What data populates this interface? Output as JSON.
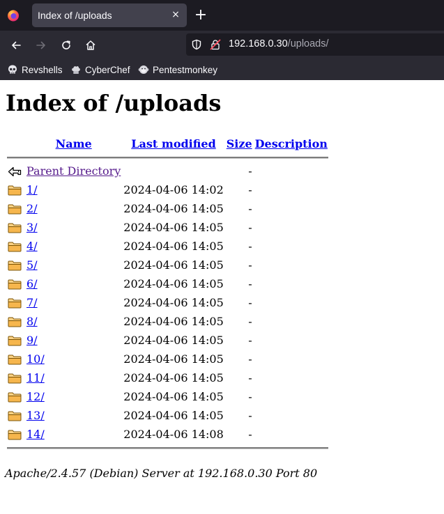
{
  "browser": {
    "tab_title": "Index of /uploads",
    "tab_close": "×",
    "new_tab": "+",
    "url_host": "192.168.0.30",
    "url_path": "/uploads/",
    "bookmarks": [
      {
        "label": "Revshells",
        "icon": "skull-icon"
      },
      {
        "label": "CyberChef",
        "icon": "chef-hat-icon"
      },
      {
        "label": "Pentestmonkey",
        "icon": "monkey-icon"
      }
    ]
  },
  "page": {
    "title": "Index of /uploads",
    "columns": {
      "name": "Name",
      "last_modified": "Last modified",
      "size": "Size",
      "description": "Description"
    },
    "parent": {
      "label": "Parent Directory",
      "size": "-"
    },
    "rows": [
      {
        "name": "1/",
        "modified": "2024-04-06 14:02",
        "size": "-"
      },
      {
        "name": "2/",
        "modified": "2024-04-06 14:05",
        "size": "-"
      },
      {
        "name": "3/",
        "modified": "2024-04-06 14:05",
        "size": "-"
      },
      {
        "name": "4/",
        "modified": "2024-04-06 14:05",
        "size": "-"
      },
      {
        "name": "5/",
        "modified": "2024-04-06 14:05",
        "size": "-"
      },
      {
        "name": "6/",
        "modified": "2024-04-06 14:05",
        "size": "-"
      },
      {
        "name": "7/",
        "modified": "2024-04-06 14:05",
        "size": "-"
      },
      {
        "name": "8/",
        "modified": "2024-04-06 14:05",
        "size": "-"
      },
      {
        "name": "9/",
        "modified": "2024-04-06 14:05",
        "size": "-"
      },
      {
        "name": "10/",
        "modified": "2024-04-06 14:05",
        "size": "-"
      },
      {
        "name": "11/",
        "modified": "2024-04-06 14:05",
        "size": "-"
      },
      {
        "name": "12/",
        "modified": "2024-04-06 14:05",
        "size": "-"
      },
      {
        "name": "13/",
        "modified": "2024-04-06 14:05",
        "size": "-"
      },
      {
        "name": "14/",
        "modified": "2024-04-06 14:08",
        "size": "-"
      }
    ],
    "footer": "Apache/2.4.57 (Debian) Server at 192.168.0.30 Port 80"
  },
  "colors": {
    "link": "#0000ee",
    "visited_link": "#551a8b",
    "chrome_dark": "#1c1b22",
    "chrome": "#2b2a33"
  }
}
